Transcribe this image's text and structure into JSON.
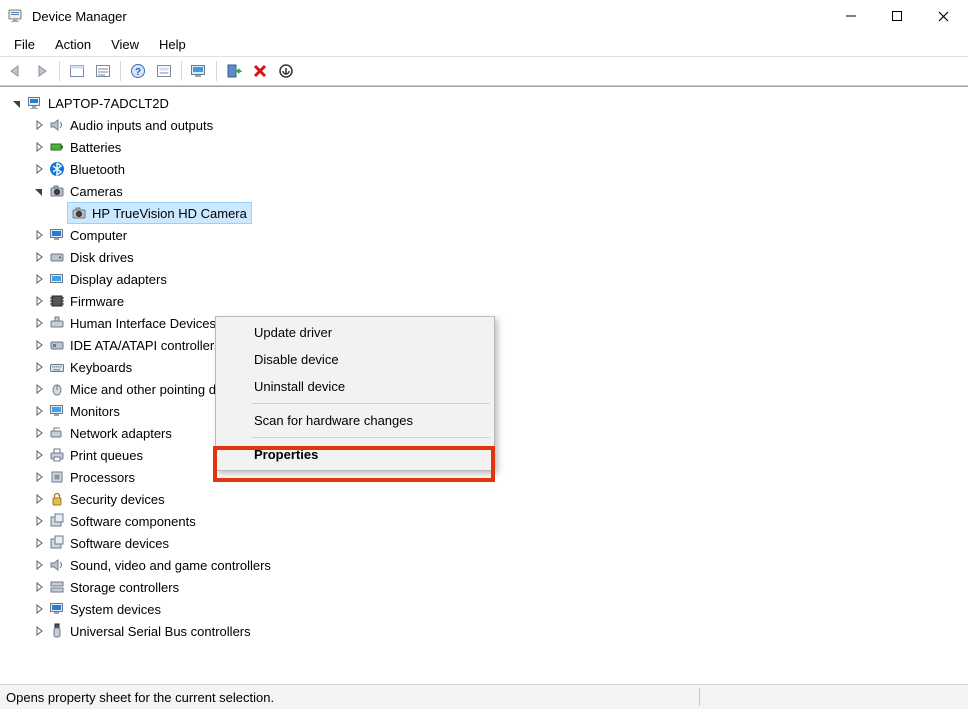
{
  "window": {
    "title": "Device Manager"
  },
  "menubar": {
    "file": "File",
    "action": "Action",
    "view": "View",
    "help": "Help"
  },
  "tree": {
    "root": "LAPTOP-7ADCLT2D",
    "audio": "Audio inputs and outputs",
    "batteries": "Batteries",
    "bluetooth": "Bluetooth",
    "cameras": "Cameras",
    "camera_device": "HP TrueVision HD Camera",
    "computer": "Computer",
    "diskdrives": "Disk drives",
    "display": "Display adapters",
    "firmware": "Firmware",
    "hid": "Human Interface Devices",
    "ide": "IDE ATA/ATAPI controllers",
    "keyboards": "Keyboards",
    "mice": "Mice and other pointing devices",
    "monitors": "Monitors",
    "network": "Network adapters",
    "printq": "Print queues",
    "processors": "Processors",
    "security": "Security devices",
    "swcomp": "Software components",
    "swdev": "Software devices",
    "sound": "Sound, video and game controllers",
    "storage": "Storage controllers",
    "system": "System devices",
    "usb": "Universal Serial Bus controllers"
  },
  "context_menu": {
    "update": "Update driver",
    "disable": "Disable device",
    "uninstall": "Uninstall device",
    "scan": "Scan for hardware changes",
    "properties": "Properties"
  },
  "statusbar": {
    "text": "Opens property sheet for the current selection."
  }
}
